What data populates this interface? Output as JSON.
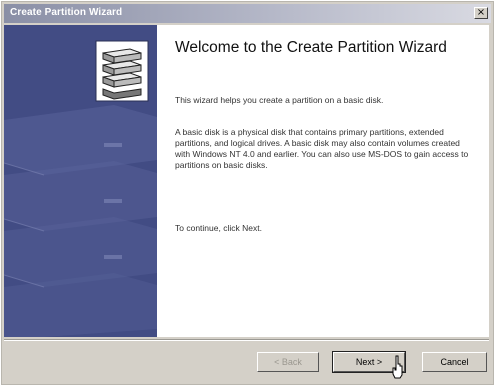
{
  "window": {
    "title": "Create Partition Wizard",
    "close_glyph": "×"
  },
  "sidebar": {
    "icon": "disk-stack-icon"
  },
  "content": {
    "heading": "Welcome to the Create Partition Wizard",
    "intro": "This wizard helps you create a partition on a basic disk.",
    "description": "A basic disk is a physical disk that contains primary partitions, extended partitions, and logical drives. A basic disk may also contain volumes created with Windows NT 4.0 and earlier. You can also use MS-DOS to gain access to partitions on basic disks.",
    "instruction": "To continue, click Next."
  },
  "buttons": {
    "back": "< Back",
    "next": "Next >",
    "cancel": "Cancel"
  },
  "colors": {
    "sidebar": "#424c84",
    "dialog": "#d4d0c8"
  }
}
